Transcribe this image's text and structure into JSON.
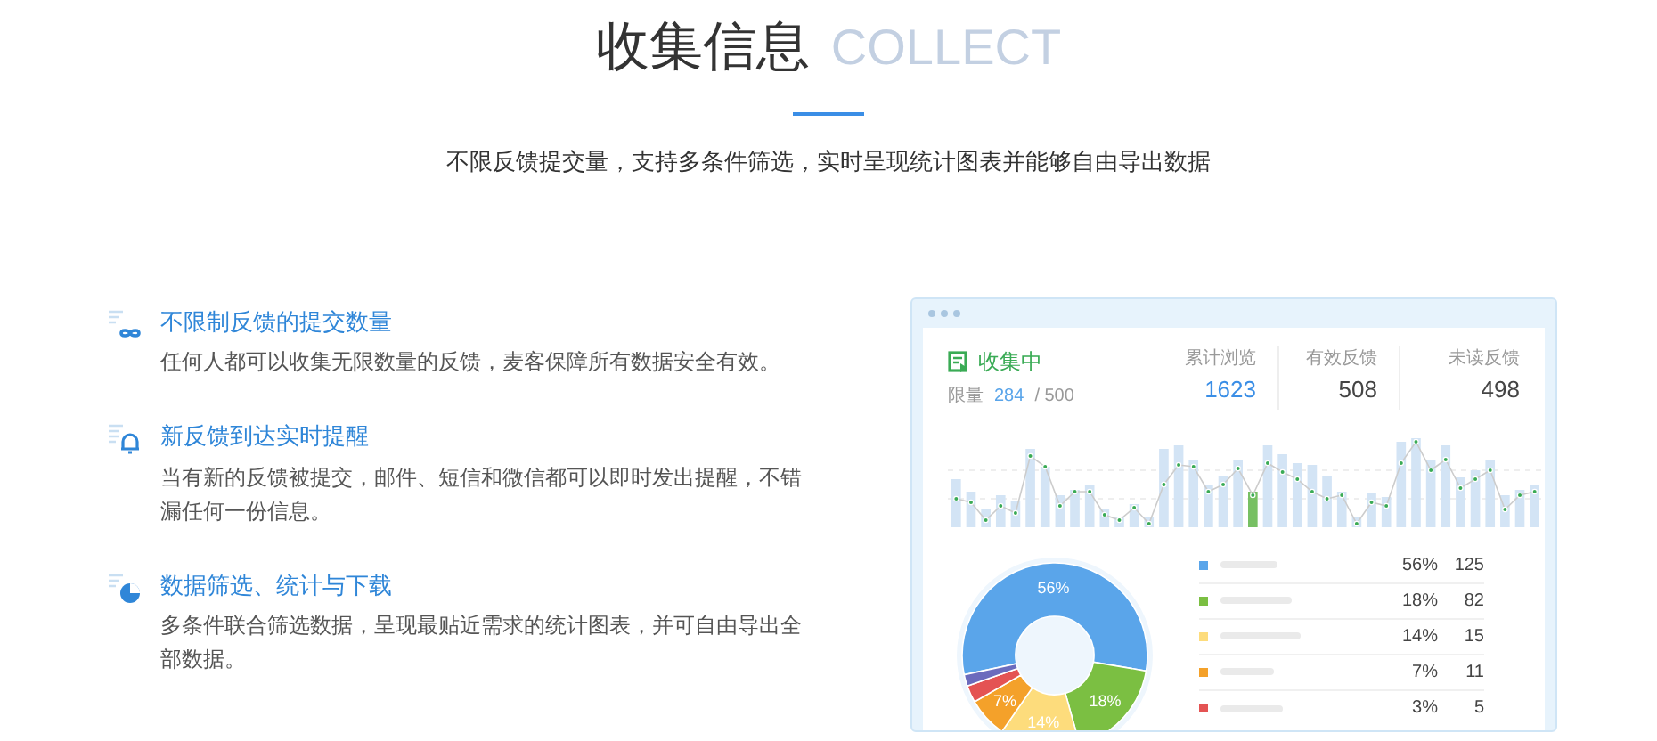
{
  "header": {
    "title": "收集信息",
    "title_en": "COLLECT",
    "subtitle": "不限反馈提交量，支持多条件筛选，实时呈现统计图表并能够自由导出数据"
  },
  "features": [
    {
      "kind": "infinity",
      "title": "不限制反馈的提交数量",
      "text": "任何人都可以收集无限数量的反馈，麦客保障所有数据安全有效。"
    },
    {
      "kind": "bell",
      "title": "新反馈到达实时提醒",
      "text": "当有新的反馈被提交，邮件、短信和微信都可以即时发出提醒，不错漏任何一份信息。"
    },
    {
      "kind": "pie",
      "title": "数据筛选、统计与下载",
      "text": "多条件联合筛选数据，呈现最贴近需求的统计图表，并可自由导出全部数据。"
    }
  ],
  "dashboard": {
    "status": "收集中",
    "limit_label": "限量",
    "limit_used": "284",
    "limit_total": "/ 500",
    "stats": [
      {
        "label": "累计浏览",
        "value": "1623",
        "highlight": true
      },
      {
        "label": "有效反馈",
        "value": "508",
        "highlight": false
      },
      {
        "label": "未读反馈",
        "value": "498",
        "highlight": false
      }
    ],
    "chart_data": {
      "type": "donut",
      "values": [
        56,
        18,
        14,
        7,
        3,
        2
      ],
      "colors": [
        "#5aa5ea",
        "#7bbf42",
        "#fddc7c",
        "#f4a12a",
        "#e45353",
        "#6b6bbd"
      ],
      "value_labels": [
        "56%",
        "18%",
        "14%",
        "7%",
        null,
        null
      ]
    },
    "legend": [
      {
        "color": "#5aa5ea",
        "percent": "56%",
        "count": "125"
      },
      {
        "color": "#7bbf42",
        "percent": "18%",
        "count": "82"
      },
      {
        "color": "#fddc7c",
        "percent": "14%",
        "count": "15"
      },
      {
        "color": "#f4a12a",
        "percent": "7%",
        "count": "11"
      },
      {
        "color": "#e45353",
        "percent": "3%",
        "count": "5"
      }
    ]
  }
}
